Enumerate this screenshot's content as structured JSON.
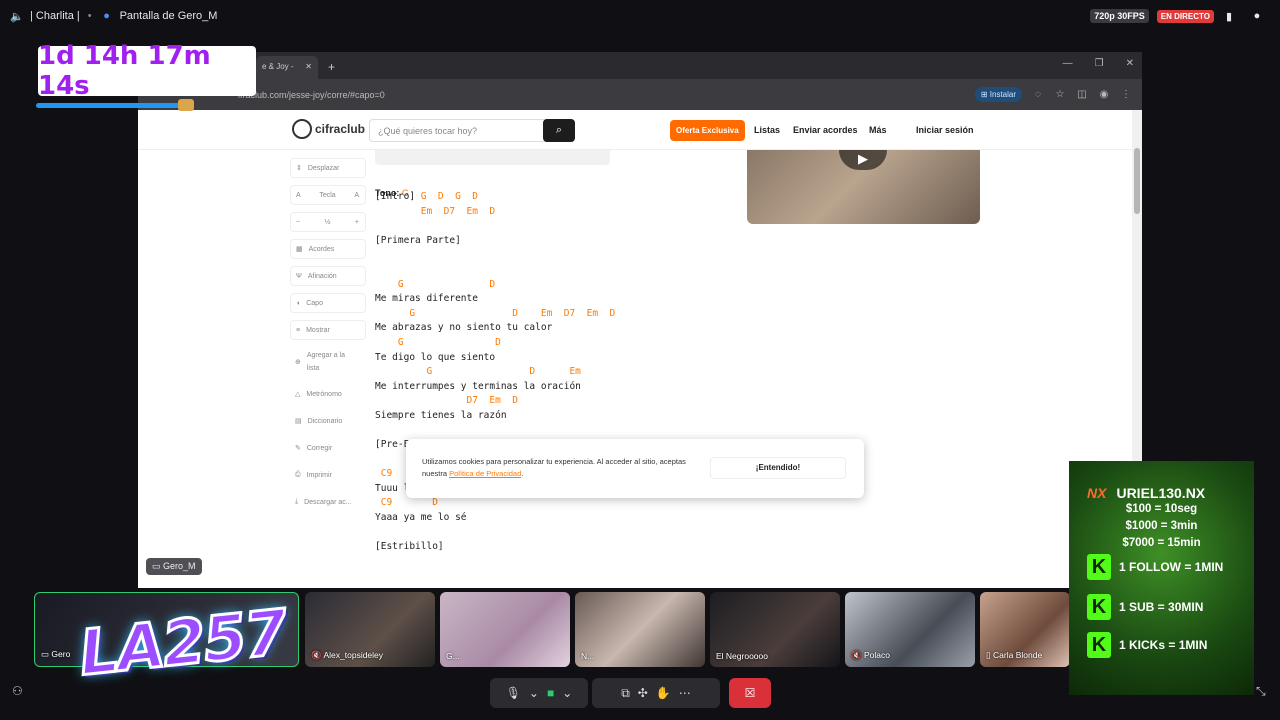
{
  "topbar": {
    "speaker_icon": "speaker-icon",
    "channel": "| Charlita |",
    "stream_title": "Pantalla de Gero_M",
    "quality": "720p 30FPS",
    "live": "EN DIRECTO"
  },
  "timer": {
    "text": "1d 14h 17m 14s",
    "progress": 0.6
  },
  "browser": {
    "tab_title": "e & Joy -",
    "url": "ifraclub.com/jesse-joy/corre/#capo=0",
    "install_label": "Instalar"
  },
  "site": {
    "logo": "cifraclub",
    "search_placeholder": "¿Qué quieres tocar hoy?",
    "offer": "Oferta Exclusiva",
    "nav": [
      "Listas",
      "Enviar acordes",
      "Más",
      "Iniciar sesión"
    ]
  },
  "tools": {
    "scroll": "Desplazar",
    "key_left": "A",
    "key_label": "Tecla",
    "key_right": "A",
    "minus": "−",
    "half": "½",
    "plus": "+",
    "chords": "Acordes",
    "tuning": "Afinación",
    "capo": "Capo",
    "show": "Mostrar",
    "add_list": "Agregar a la lista",
    "metronome": "Metrónomo",
    "dictionary": "Diccionario",
    "correct": "Corregir",
    "print": "Imprimir",
    "download": "Descargar ac..."
  },
  "song": {
    "tono_label": "Tono:",
    "tono_value": "G",
    "lines": [
      {
        "type": "text",
        "text": "[Intro] "
      },
      {
        "type": "chord",
        "text": "        Em  D7  Em  D"
      },
      {
        "type": "blank",
        "text": " "
      },
      {
        "type": "text",
        "text": "[Primera Parte]"
      },
      {
        "type": "blank",
        "text": " "
      },
      {
        "type": "blank",
        "text": " "
      },
      {
        "type": "chord",
        "text": "    G               D"
      },
      {
        "type": "text",
        "text": "Me miras diferente"
      },
      {
        "type": "chord",
        "text": "      G                 D    Em  D7  Em  D"
      },
      {
        "type": "text",
        "text": "Me abrazas y no siento tu calor"
      },
      {
        "type": "chord",
        "text": "    G                D"
      },
      {
        "type": "text",
        "text": "Te digo lo que siento"
      },
      {
        "type": "chord",
        "text": "         G                 D      Em"
      },
      {
        "type": "text",
        "text": "Me interrumpes y terminas la oración"
      },
      {
        "type": "chord",
        "text": "                D7  Em  D"
      },
      {
        "type": "text",
        "text": "Siempre tienes la razón"
      },
      {
        "type": "blank",
        "text": " "
      },
      {
        "type": "text",
        "text": "[Pre-E"
      },
      {
        "type": "blank",
        "text": " "
      },
      {
        "type": "chord",
        "text": " C9"
      },
      {
        "type": "text",
        "text": "Tuuu libreto de siempre tan prede__cible"
      },
      {
        "type": "chord",
        "text": " C9       D"
      },
      {
        "type": "text",
        "text": "Yaaa ya me lo sé"
      },
      {
        "type": "blank",
        "text": " "
      },
      {
        "type": "text",
        "text": "[Estribillo]"
      }
    ],
    "intro_chords": "G  D  G  D"
  },
  "cookie": {
    "text": "Utilizamos cookies para personalizar tu experiencia. Al acceder al sitio, aceptas nuestra",
    "link": "Política de Privacidad",
    "dot": ".",
    "button": "¡Entendido!"
  },
  "stream_tag": "Gero_M",
  "participants": [
    {
      "name": "Gero"
    },
    {
      "name": "Alex_topsideley"
    },
    {
      "name": "G..."
    },
    {
      "name": "N..."
    },
    {
      "name": "El Negrooooo"
    },
    {
      "name": "Polaco"
    },
    {
      "name": "Carla Blonde"
    }
  ],
  "overlay_logo": "LA257",
  "promo": {
    "brand": "NX",
    "user": "URIEL130.NX",
    "rates": [
      "$100 = 10seg",
      "$1000 = 3min",
      "$7000 = 15min"
    ],
    "rows": [
      "1 FOLLOW = 1MIN",
      "1 SUB = 30MIN",
      "1 KICKs = 1MIN"
    ],
    "k": "K"
  },
  "colors": {
    "chord": "#ff7a00",
    "offer": "#ff6b00",
    "live": "#e03a3a",
    "kick_green": "#53fc18",
    "timer_text": "#a020f0"
  }
}
